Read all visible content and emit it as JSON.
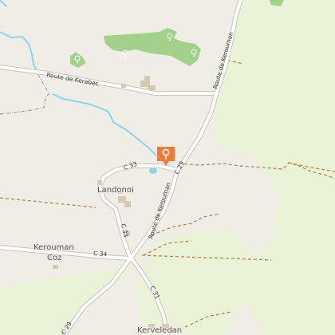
{
  "map": {
    "colors": {
      "land": "#f0ede6",
      "meadow": "#eaf2d8",
      "forest": "#a3d08a",
      "road_fill": "#ffffff",
      "road_casing": "#c9c3b8",
      "water": "#8ed3ee",
      "building": "#d6c9b0",
      "track": "#b38a4a",
      "boundary": "#a295a8",
      "marker": "#f07a38"
    },
    "road_labels": {
      "kerabec": "Route de Kerabec",
      "kerouman_north": "Route de Kerouman",
      "kerouman_south": "Route de Kerouman",
      "c29_north": "C 29",
      "c29_south": "C 29",
      "c33_upper": "C 33",
      "c33_lower": "C 33",
      "c34": "C 34",
      "c31": "C 31"
    },
    "place_labels": {
      "landonoi": "Landonoi",
      "kerouman_coz_line1": "Kerouman",
      "kerouman_coz_line2": "Coz",
      "kerveledan": "Kerveledan"
    },
    "icons": {
      "marker": "map-marker-icon",
      "tree": "tree-icon"
    }
  }
}
